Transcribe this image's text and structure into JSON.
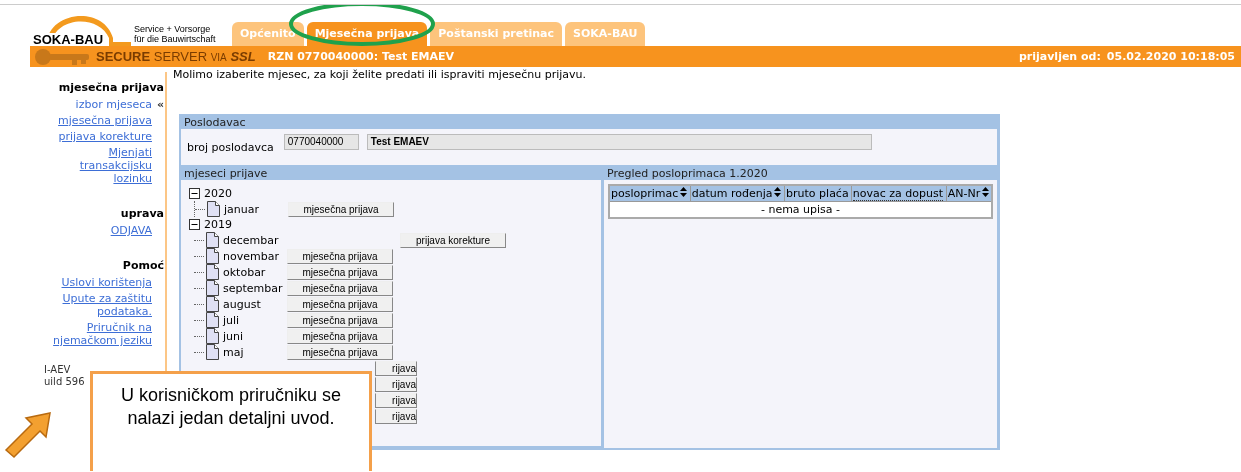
{
  "header": {
    "logo": "SOKA-BAU",
    "tagline": [
      "Service + Vorsorge",
      "für die Bauwirtschaft"
    ],
    "tabs": [
      {
        "label": "Općenito",
        "selected": false
      },
      {
        "label": "Mjesečna prijava",
        "selected": true
      },
      {
        "label": "Poštanski pretinac",
        "selected": false
      },
      {
        "label": "SOKA-BAU",
        "selected": false
      }
    ]
  },
  "bar": {
    "secure": [
      "SECURE",
      "SERVER",
      "VIA",
      "SSL"
    ],
    "account": "RZN 0770040000: Test EMAEV",
    "login_label": "prijavljen od:",
    "login_time": "05.02.2020 10:18:05"
  },
  "sidebar": {
    "selected_marker": "«",
    "sections": [
      {
        "title": "mjesečna prijava",
        "items": [
          {
            "label": "izbor mjeseca",
            "selected": true
          },
          {
            "label": "mjesečna prijava",
            "selected": false
          },
          {
            "label": "prijava korekture",
            "selected": false
          },
          {
            "label": "Mjenjati transakcijsku lozinku",
            "selected": false
          }
        ]
      },
      {
        "title": "uprava",
        "items": [
          {
            "label": "ODJAVA",
            "selected": false
          }
        ]
      },
      {
        "title": "Pomoć",
        "items": [
          {
            "label": "Uslovi korištenja",
            "selected": false
          },
          {
            "label": "Upute za zaštitu podataka.",
            "selected": false
          },
          {
            "label": "Priručnik na njemačkom jeziku",
            "selected": false
          }
        ]
      }
    ],
    "version_lines": [
      "I-AEV",
      "uild 596"
    ]
  },
  "main": {
    "intro": "Molimo izaberite mjesec, za koji želite predati ili ispraviti mjesečnu prijavu.",
    "employer": {
      "title": "Poslodavac",
      "label": "broj poslodavca",
      "number": "0770040000",
      "name": "Test EMAEV"
    },
    "months": {
      "title": "mjeseci prijave",
      "years": [
        {
          "label": "2020",
          "expanded": true,
          "children": [
            {
              "label": "januar",
              "kind": "report",
              "button": "mjesečna prijava"
            }
          ]
        },
        {
          "label": "2019",
          "expanded": true,
          "children": [
            {
              "label": "decembar",
              "kind": "correction",
              "button": "prijava korekture"
            },
            {
              "label": "novembar",
              "kind": "report",
              "button": "mjesečna prijava"
            },
            {
              "label": "oktobar",
              "kind": "report",
              "button": "mjesečna prijava"
            },
            {
              "label": "septembar",
              "kind": "report",
              "button": "mjesečna prijava"
            },
            {
              "label": "august",
              "kind": "report",
              "button": "mjesečna prijava"
            },
            {
              "label": "juli",
              "kind": "report",
              "button": "mjesečna prijava"
            },
            {
              "label": "juni",
              "kind": "report",
              "button": "mjesečna prijava"
            },
            {
              "label": "maj",
              "kind": "report",
              "button": "mjesečna prijava"
            },
            {
              "kind": "covered",
              "button": "rijava"
            },
            {
              "kind": "covered",
              "button": "rijava"
            },
            {
              "kind": "covered",
              "button": "rijava"
            },
            {
              "kind": "covered",
              "button": "rijava"
            }
          ]
        }
      ]
    },
    "overview": {
      "title": "Pregled posloprimaca 1.2020",
      "columns": [
        {
          "label": "posloprimac",
          "kind": "sort"
        },
        {
          "label": "datum rođenja",
          "kind": "sort"
        },
        {
          "label": "bruto plaća",
          "kind": "plain"
        },
        {
          "label": "novac za dopust",
          "kind": "hint"
        },
        {
          "label": "AN-Nr",
          "kind": "sort"
        }
      ],
      "empty_text": "- nema upisa -"
    }
  },
  "callout": {
    "text": "U korisničkom priručniku se nalazi jedan detaljni uvod."
  }
}
